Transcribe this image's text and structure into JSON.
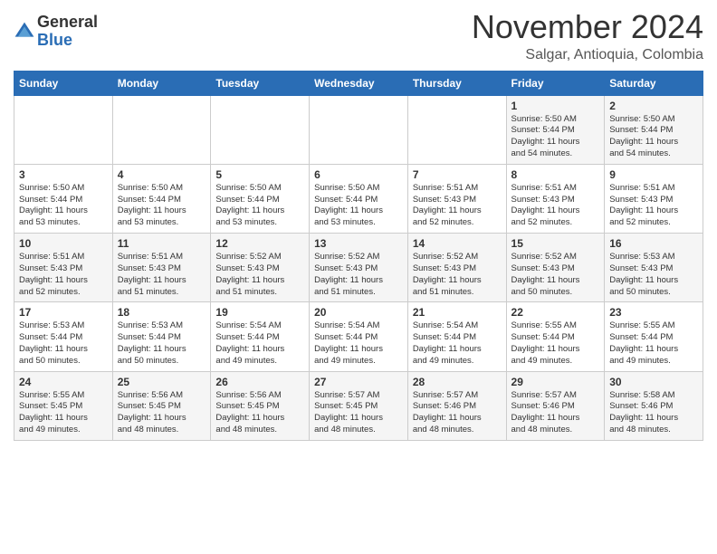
{
  "logo": {
    "general": "General",
    "blue": "Blue"
  },
  "header": {
    "month": "November 2024",
    "location": "Salgar, Antioquia, Colombia"
  },
  "weekdays": [
    "Sunday",
    "Monday",
    "Tuesday",
    "Wednesday",
    "Thursday",
    "Friday",
    "Saturday"
  ],
  "weeks": [
    [
      {
        "day": "",
        "info": ""
      },
      {
        "day": "",
        "info": ""
      },
      {
        "day": "",
        "info": ""
      },
      {
        "day": "",
        "info": ""
      },
      {
        "day": "",
        "info": ""
      },
      {
        "day": "1",
        "info": "Sunrise: 5:50 AM\nSunset: 5:44 PM\nDaylight: 11 hours\nand 54 minutes."
      },
      {
        "day": "2",
        "info": "Sunrise: 5:50 AM\nSunset: 5:44 PM\nDaylight: 11 hours\nand 54 minutes."
      }
    ],
    [
      {
        "day": "3",
        "info": "Sunrise: 5:50 AM\nSunset: 5:44 PM\nDaylight: 11 hours\nand 53 minutes."
      },
      {
        "day": "4",
        "info": "Sunrise: 5:50 AM\nSunset: 5:44 PM\nDaylight: 11 hours\nand 53 minutes."
      },
      {
        "day": "5",
        "info": "Sunrise: 5:50 AM\nSunset: 5:44 PM\nDaylight: 11 hours\nand 53 minutes."
      },
      {
        "day": "6",
        "info": "Sunrise: 5:50 AM\nSunset: 5:44 PM\nDaylight: 11 hours\nand 53 minutes."
      },
      {
        "day": "7",
        "info": "Sunrise: 5:51 AM\nSunset: 5:43 PM\nDaylight: 11 hours\nand 52 minutes."
      },
      {
        "day": "8",
        "info": "Sunrise: 5:51 AM\nSunset: 5:43 PM\nDaylight: 11 hours\nand 52 minutes."
      },
      {
        "day": "9",
        "info": "Sunrise: 5:51 AM\nSunset: 5:43 PM\nDaylight: 11 hours\nand 52 minutes."
      }
    ],
    [
      {
        "day": "10",
        "info": "Sunrise: 5:51 AM\nSunset: 5:43 PM\nDaylight: 11 hours\nand 52 minutes."
      },
      {
        "day": "11",
        "info": "Sunrise: 5:51 AM\nSunset: 5:43 PM\nDaylight: 11 hours\nand 51 minutes."
      },
      {
        "day": "12",
        "info": "Sunrise: 5:52 AM\nSunset: 5:43 PM\nDaylight: 11 hours\nand 51 minutes."
      },
      {
        "day": "13",
        "info": "Sunrise: 5:52 AM\nSunset: 5:43 PM\nDaylight: 11 hours\nand 51 minutes."
      },
      {
        "day": "14",
        "info": "Sunrise: 5:52 AM\nSunset: 5:43 PM\nDaylight: 11 hours\nand 51 minutes."
      },
      {
        "day": "15",
        "info": "Sunrise: 5:52 AM\nSunset: 5:43 PM\nDaylight: 11 hours\nand 50 minutes."
      },
      {
        "day": "16",
        "info": "Sunrise: 5:53 AM\nSunset: 5:43 PM\nDaylight: 11 hours\nand 50 minutes."
      }
    ],
    [
      {
        "day": "17",
        "info": "Sunrise: 5:53 AM\nSunset: 5:44 PM\nDaylight: 11 hours\nand 50 minutes."
      },
      {
        "day": "18",
        "info": "Sunrise: 5:53 AM\nSunset: 5:44 PM\nDaylight: 11 hours\nand 50 minutes."
      },
      {
        "day": "19",
        "info": "Sunrise: 5:54 AM\nSunset: 5:44 PM\nDaylight: 11 hours\nand 49 minutes."
      },
      {
        "day": "20",
        "info": "Sunrise: 5:54 AM\nSunset: 5:44 PM\nDaylight: 11 hours\nand 49 minutes."
      },
      {
        "day": "21",
        "info": "Sunrise: 5:54 AM\nSunset: 5:44 PM\nDaylight: 11 hours\nand 49 minutes."
      },
      {
        "day": "22",
        "info": "Sunrise: 5:55 AM\nSunset: 5:44 PM\nDaylight: 11 hours\nand 49 minutes."
      },
      {
        "day": "23",
        "info": "Sunrise: 5:55 AM\nSunset: 5:44 PM\nDaylight: 11 hours\nand 49 minutes."
      }
    ],
    [
      {
        "day": "24",
        "info": "Sunrise: 5:55 AM\nSunset: 5:45 PM\nDaylight: 11 hours\nand 49 minutes."
      },
      {
        "day": "25",
        "info": "Sunrise: 5:56 AM\nSunset: 5:45 PM\nDaylight: 11 hours\nand 48 minutes."
      },
      {
        "day": "26",
        "info": "Sunrise: 5:56 AM\nSunset: 5:45 PM\nDaylight: 11 hours\nand 48 minutes."
      },
      {
        "day": "27",
        "info": "Sunrise: 5:57 AM\nSunset: 5:45 PM\nDaylight: 11 hours\nand 48 minutes."
      },
      {
        "day": "28",
        "info": "Sunrise: 5:57 AM\nSunset: 5:46 PM\nDaylight: 11 hours\nand 48 minutes."
      },
      {
        "day": "29",
        "info": "Sunrise: 5:57 AM\nSunset: 5:46 PM\nDaylight: 11 hours\nand 48 minutes."
      },
      {
        "day": "30",
        "info": "Sunrise: 5:58 AM\nSunset: 5:46 PM\nDaylight: 11 hours\nand 48 minutes."
      }
    ]
  ]
}
